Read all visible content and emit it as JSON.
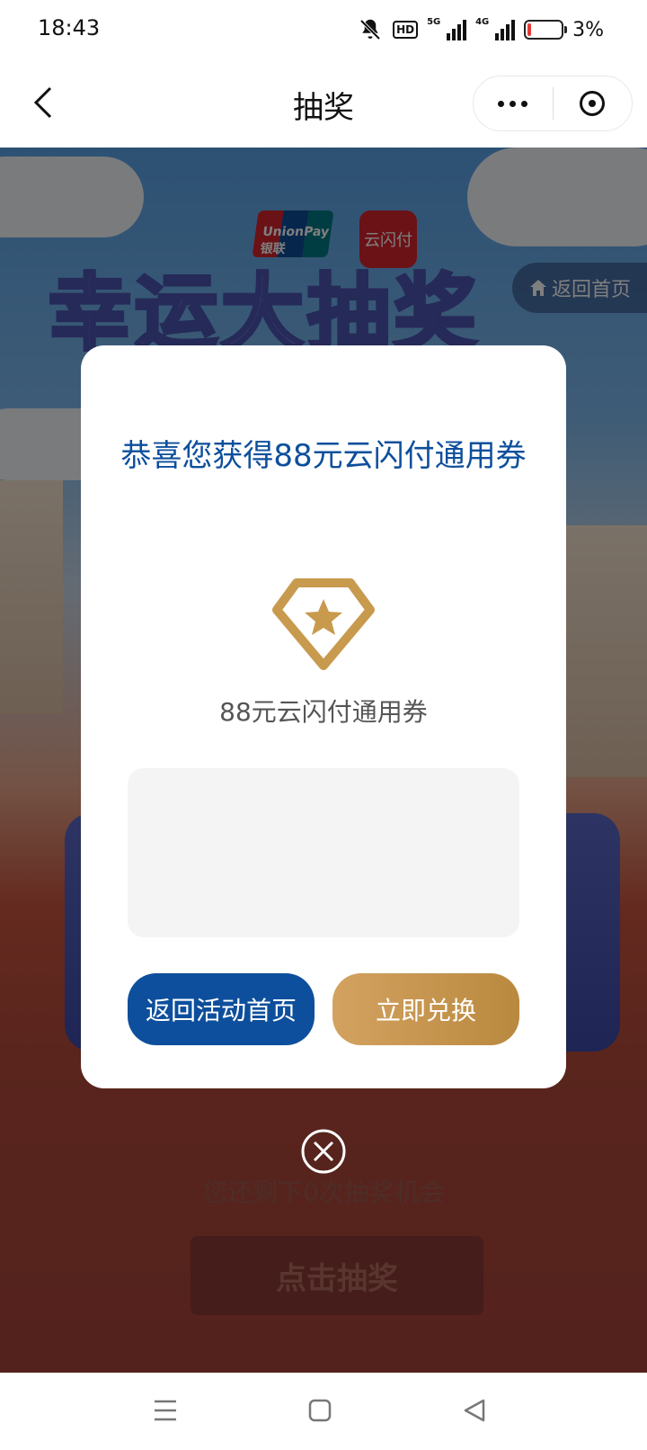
{
  "status_bar": {
    "time": "18:43",
    "hd_label": "HD",
    "sim1_label": "5G",
    "sim2_label": "4G",
    "battery_pct": "3%",
    "battery_level": 0.03,
    "icons": [
      "bell-off-icon",
      "signal-icon",
      "battery-icon"
    ]
  },
  "nav": {
    "title": "抽奖",
    "icons": [
      "back-chevron-icon",
      "more-dots-icon",
      "close-circle-icon"
    ]
  },
  "background": {
    "logo_unionpay_text": "UnionPay 银联",
    "logo_yunshanfu_text": "云闪付",
    "title": "幸运大抽奖",
    "back_home_label": "返回首页",
    "chances_text": "您还剩下0次抽奖机会",
    "draw_button_label": "点击抽奖"
  },
  "modal": {
    "title": "恭喜您获得88元云闪付通用券",
    "prize_icon": "diamond-star-icon",
    "prize_name": "88元云闪付通用券",
    "code_value": "",
    "back_button_label": "返回活动首页",
    "redeem_button_label": "立即兑换",
    "close_icon": "close-circle-icon"
  },
  "colors": {
    "brand_blue": "#0d4f9c",
    "gold": "#c89a4e",
    "unionpay_red": "#d7252e"
  },
  "system_nav": {
    "icons": [
      "menu-icon",
      "home-square-icon",
      "back-triangle-icon"
    ]
  }
}
